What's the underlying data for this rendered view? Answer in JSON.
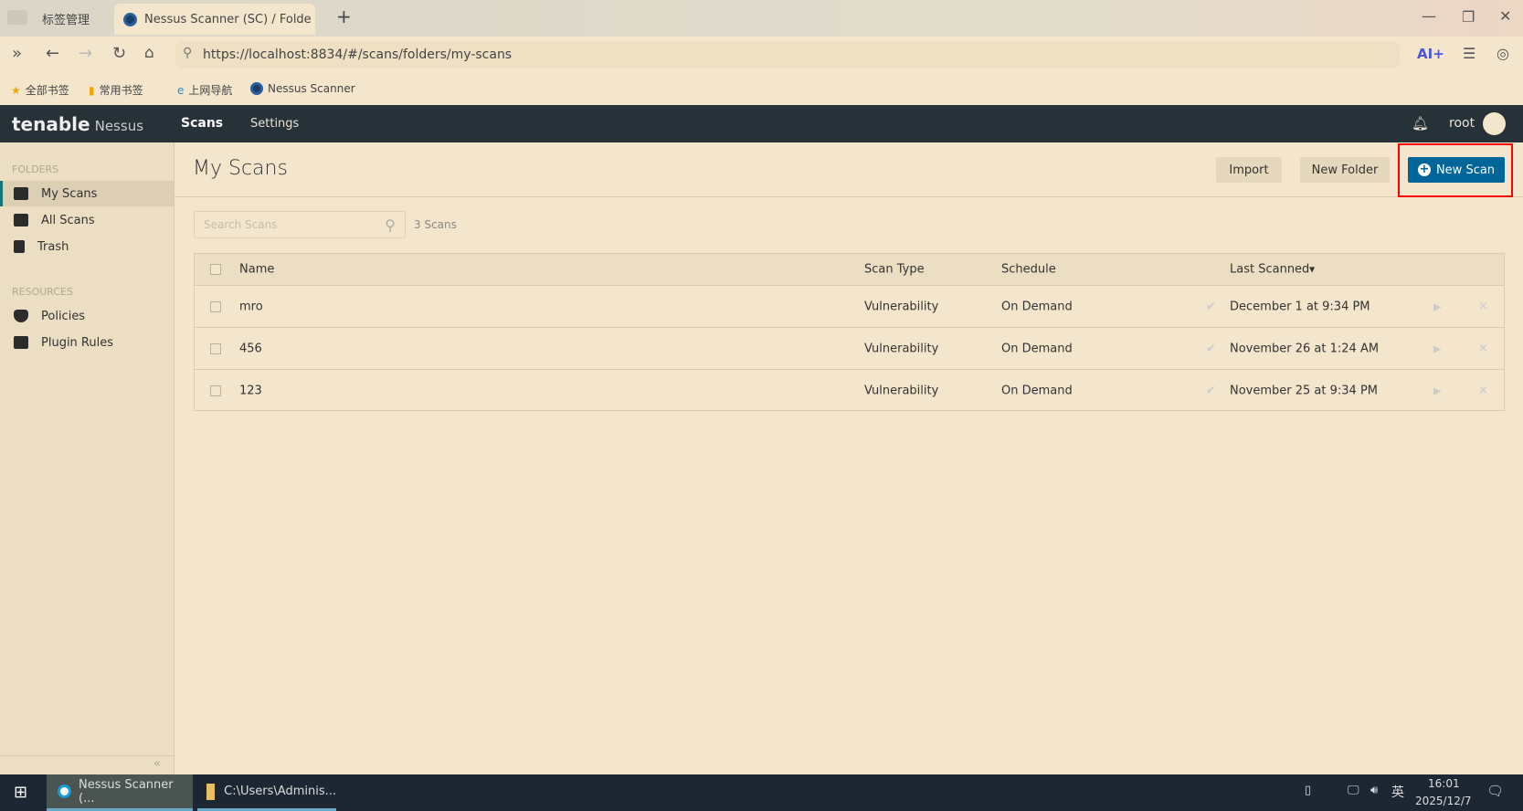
{
  "browser": {
    "tab_manager": "标签管理",
    "tab_title": "Nessus Scanner (SC) / Folde",
    "url": "https://localhost:8834/#/scans/folders/my-scans",
    "ai_label": "AI+",
    "bookmarks": [
      "全部书签",
      "常用书签",
      "上网导航",
      "Nessus Scanner"
    ]
  },
  "nav": {
    "brand": "tenable",
    "product": "Nessus",
    "items": [
      "Scans",
      "Settings"
    ],
    "user": "root"
  },
  "sidebar": {
    "folders_heading": "FOLDERS",
    "folders": [
      "My Scans",
      "All Scans",
      "Trash"
    ],
    "resources_heading": "RESOURCES",
    "resources": [
      "Policies",
      "Plugin Rules"
    ],
    "collapse": "«"
  },
  "main": {
    "title": "My Scans",
    "import_label": "Import",
    "new_folder_label": "New Folder",
    "new_scan_label": "New Scan",
    "search_placeholder": "Search Scans",
    "scan_count": "3 Scans",
    "columns": [
      "Name",
      "Scan Type",
      "Schedule",
      "Last Scanned"
    ],
    "rows": [
      {
        "name": "mro",
        "type": "Vulnerability",
        "schedule": "On Demand",
        "last": "December 1 at 9:34 PM"
      },
      {
        "name": "456",
        "type": "Vulnerability",
        "schedule": "On Demand",
        "last": "November 26 at 1:24 AM"
      },
      {
        "name": "123",
        "type": "Vulnerability",
        "schedule": "On Demand",
        "last": "November 25 at 9:34 PM"
      }
    ]
  },
  "taskbar": {
    "apps": [
      "Nessus Scanner (...",
      "C:\\Users\\Adminis..."
    ],
    "ime": "英",
    "time": "16:01",
    "date": "2025/12/7"
  },
  "colors": {
    "accent": "#006699",
    "nav": "#263238",
    "highlight": "#ff0000"
  }
}
